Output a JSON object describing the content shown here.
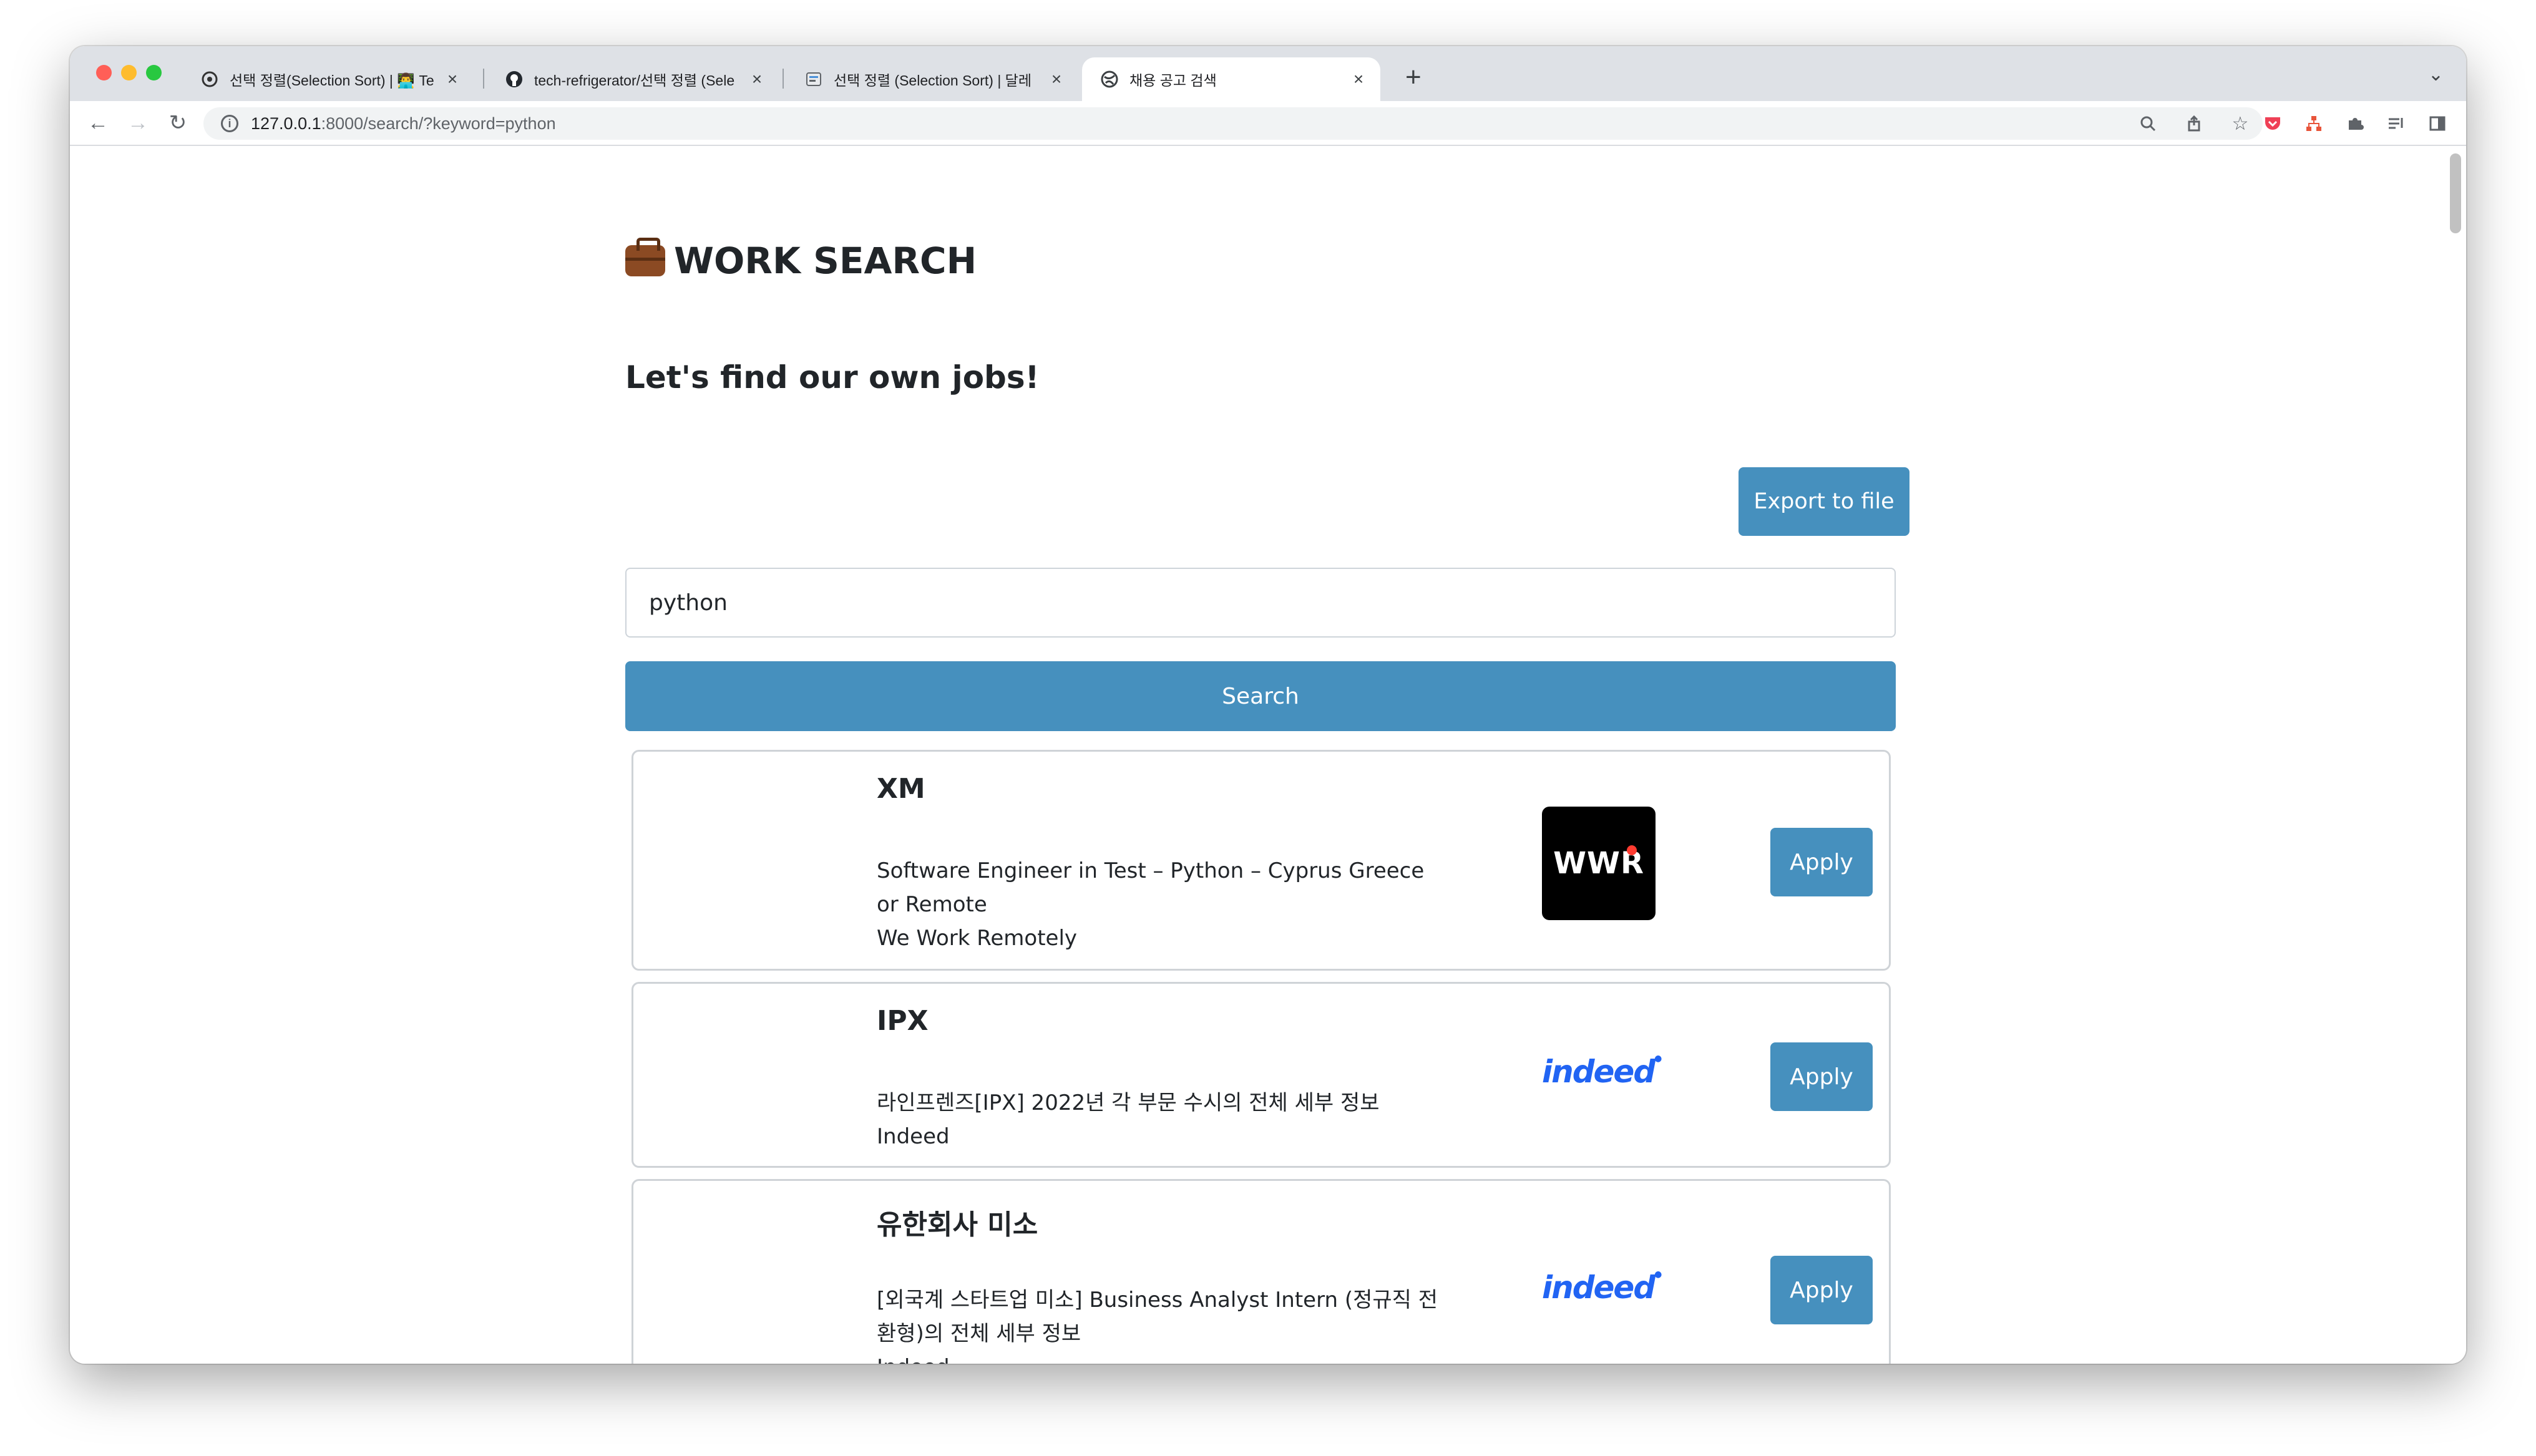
{
  "browser": {
    "tabs": [
      {
        "title": "선택 정렬(Selection Sort) | 👨‍💻 Te",
        "icon": "github-octocat-icon"
      },
      {
        "title": "tech-refrigerator/선택 정렬 (Sele",
        "icon": "github-icon"
      },
      {
        "title": "선택 정렬 (Selection Sort) | 달레",
        "icon": "blog-icon"
      },
      {
        "title": "채용 공고 검색",
        "icon": "globe-icon",
        "active": true
      }
    ],
    "close_glyph": "×",
    "new_tab_glyph": "+",
    "url_host": "127.0.0.1",
    "url_rest": ":8000/search/?keyword=python"
  },
  "page": {
    "brand": "WORK SEARCH",
    "tagline": "Let's find our own jobs!",
    "export_label": "Export to file",
    "search_value": "python",
    "search_label": "Search",
    "apply_label": "Apply"
  },
  "jobs": [
    {
      "company": "XM",
      "title": "Software Engineer in Test – Python – Cyprus Greece or Remote",
      "source": "We Work Remotely",
      "logo": "WWR"
    },
    {
      "company": "IPX",
      "title": "라인프렌즈[IPX] 2022년 각 부문 수시의 전체 세부 정보",
      "source": "Indeed",
      "logo": "indeed"
    },
    {
      "company": "유한회사 미소",
      "title": "[외국계 스타트업 미소] Business Analyst Intern (정규직 전환형)의 전체 세부 정보",
      "source": "Indeed",
      "logo": "indeed"
    }
  ],
  "colors": {
    "primary": "#4690be",
    "indeed_blue": "#2164f3",
    "tabstrip": "#dee1e6"
  }
}
